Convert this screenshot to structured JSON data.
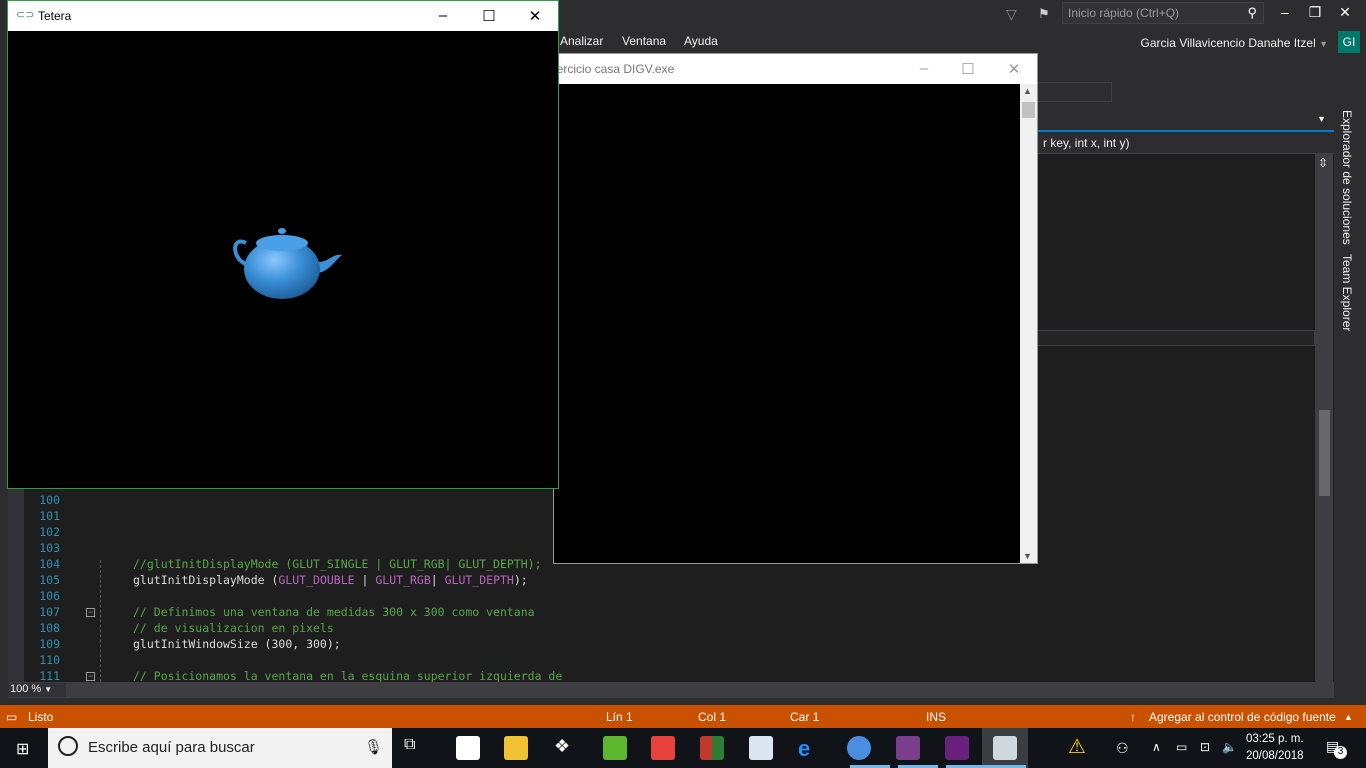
{
  "vs": {
    "quick_launch_placeholder": "Inicio rápido (Ctrl+Q)",
    "menu": [
      "Analizar",
      "Ventana",
      "Ayuda"
    ],
    "user": "Garcia Villavicencio Danahe Itzel",
    "avatar": "GI",
    "nav_member": "r key, int x, int y)",
    "zoom": "100 %",
    "side_tabs": [
      "Explorador de soluciones",
      "Team Explorer"
    ],
    "code": [
      {
        "n": "100",
        "t": ""
      },
      {
        "n": "101",
        "t": ""
      },
      {
        "n": "102",
        "t": ""
      },
      {
        "n": "103",
        "t": ""
      },
      {
        "n": "104",
        "t": "//glutInitDisplayMode (GLUT_SINGLE | GLUT_RGB| GLUT_DEPTH);"
      },
      {
        "n": "105",
        "t": "glutInitDisplayMode (GLUT_DOUBLE | GLUT_RGB| GLUT_DEPTH);"
      },
      {
        "n": "106",
        "t": ""
      },
      {
        "n": "107",
        "t": "// Definimos una ventana de medidas 300 x 300 como ventana"
      },
      {
        "n": "108",
        "t": "// de visualizacion en pixels"
      },
      {
        "n": "109",
        "t": "glutInitWindowSize (300, 300);"
      },
      {
        "n": "110",
        "t": ""
      },
      {
        "n": "111",
        "t": "// Posicionamos la ventana en la esquina superior izquierda de"
      }
    ],
    "code_parts": {
      "fn105": "glutInitDisplayMode (",
      "m1": "GLUT_DOUBLE",
      "s1": " | ",
      "m2": "GLUT_RGB",
      "s2": "| ",
      "m3": "GLUT_DEPTH",
      "e": ");"
    }
  },
  "status": {
    "ready": "Listo",
    "line": "Lín 1",
    "col": "Col 1",
    "car": "Car 1",
    "ins": "INS",
    "source_control": "Agregar al control de código fuente"
  },
  "tetera_window": {
    "title": "Tetera"
  },
  "console_window": {
    "title": "jercicio casa DIGV.exe"
  },
  "taskbar": {
    "search_placeholder": "Escribe aquí para buscar",
    "time": "03:25 p. m.",
    "date": "20/08/2018",
    "notifications": "3"
  },
  "colors": {
    "accent": "#007acc",
    "status": "#ca5100",
    "teapot": "#3a8fd6"
  }
}
